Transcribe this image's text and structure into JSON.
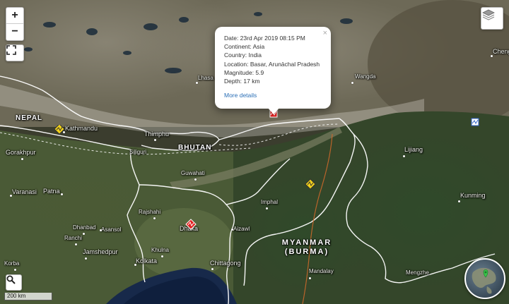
{
  "controls": {
    "zoom_in": "+",
    "zoom_out": "−",
    "fullscreen_icon": "fullscreen-icon",
    "search_icon": "search-icon",
    "layers_icon": "layers-icon"
  },
  "scale_label": "200 km",
  "popup": {
    "date": "Date: 23rd Apr 2019 08:15 PM",
    "continent": "Continent: Asia",
    "country": "Country: India",
    "location": "Location: Basar, Arunāchal Pradesh",
    "magnitude": "Magnitude: 5.9",
    "depth": "Depth: 17 km",
    "more": "More details",
    "close": "×"
  },
  "countries": {
    "nepal": "NEPAL",
    "bhutan": "BHUTAN",
    "myanmar_line1": "MYANMAR",
    "myanmar_line2": "(BURMA)"
  },
  "cities": {
    "kathmandu": "Kathmandu",
    "thimphu": "Thimphu",
    "lhasa": "Lhasa",
    "wangda": "Wangda",
    "cheng": "Cheng",
    "gorakhpur": "Gorakhpur",
    "siliguri": "Siliguri",
    "guwahati": "Guwahati",
    "lijiang": "Lijiang",
    "kunming": "Kunming",
    "varanasi": "Varanasi",
    "patna": "Patna",
    "rajshahi": "Rajshahi",
    "imphal": "Imphal",
    "dhanbad": "Dhanbad",
    "asansol": "Asansol",
    "dhaka": "Dhaka",
    "aizawl": "Aizawl",
    "ranchi": "Ranchi",
    "jamshedpur": "Jamshedpur",
    "khulna": "Khulna",
    "kolkata": "Kolkata",
    "chittagong": "Chittagong",
    "mandalay": "Mandalay",
    "mengzhe": "Mengzhe",
    "korba": "Korba"
  },
  "colors": {
    "quake_red": "#e02020",
    "quake_yellow": "#f2d21b",
    "popup_link": "#2b6fb6",
    "border_line": "#ffffff"
  }
}
